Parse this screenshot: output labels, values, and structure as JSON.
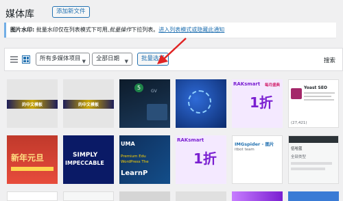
{
  "header": {
    "title": "媒体库",
    "add_new": "添加新文件"
  },
  "notice": {
    "label": "图片水印:",
    "text1": " 批量水印仅在列表模式下可用,",
    "text_italic": "批量操作",
    "text2": "下拉列表。",
    "link": "进入列表模式或隐藏此通知"
  },
  "toolbar": {
    "type_filter": "所有多媒体项目",
    "date_filter": "全部日期",
    "bulk_select": "批量选择",
    "search": "搜索"
  },
  "thumbs": {
    "t1_caption": "的中文模板",
    "t2_caption": "的中文模板",
    "t3_badge": "5",
    "t3_text": "GV",
    "t5_brand": "RAKsmart",
    "t5_promo": "每月盛典",
    "t5_big": "1折",
    "t6_title": "Yoast SEO",
    "t6_count": "(27,421)",
    "t7_big": "新年元旦",
    "t8_line1": "SIMPLY",
    "t8_line2": "IMPECCABLE",
    "t9_brand": "UMA",
    "t9_text1": "Premium Edu",
    "t9_text2": "WordPress The",
    "t9_text3": "LearnP",
    "t10_brand": "RAKsmart",
    "t10_big": "1折",
    "t11_title": "IMGspider - 图片",
    "t11_meta": "itbot team",
    "t12_label": "伍哈蓝",
    "t12_sub": "全部类型"
  },
  "colors": {
    "accent": "#2271b1",
    "arrow": "#e02424",
    "notice_border": "#72aee6"
  }
}
